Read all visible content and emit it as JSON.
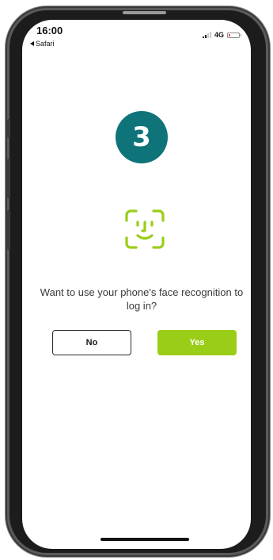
{
  "status_bar": {
    "time": "16:00",
    "back_app": "Safari",
    "network": "4G",
    "battery_level": 0.15,
    "signal_bars_active": 2,
    "signal_bars_total": 4,
    "battery_color": "#e23b2e"
  },
  "step": {
    "number": "3",
    "color": "#0e7479"
  },
  "face_icon": {
    "name": "face-recognition-icon",
    "color": "#9acd17"
  },
  "prompt": {
    "text": "Want to use your phone's face recognition to log in?"
  },
  "buttons": {
    "no_label": "No",
    "yes_label": "Yes",
    "yes_color": "#9acd17"
  }
}
